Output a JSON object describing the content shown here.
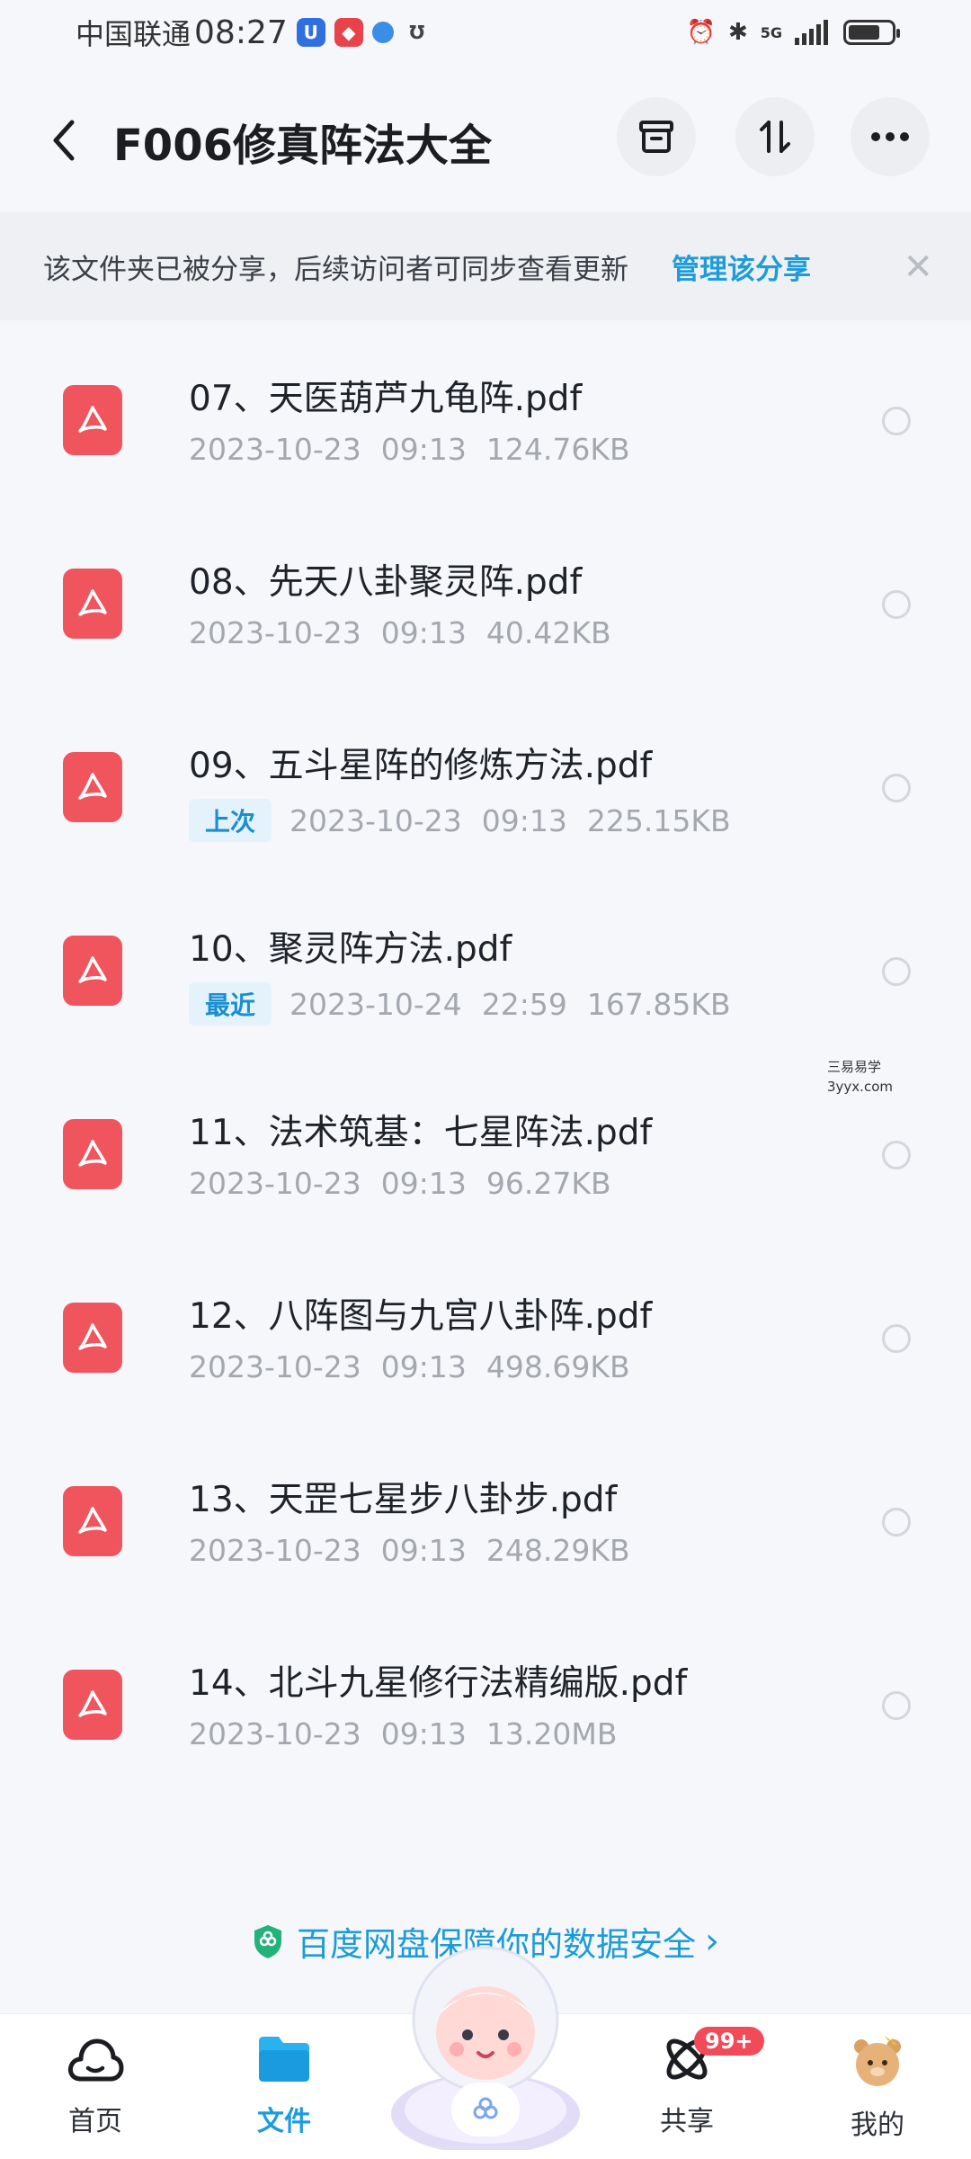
{
  "status_bar": {
    "carrier": "中国联通",
    "time": "08:27",
    "network": "5G"
  },
  "header": {
    "title": "F006修真阵法大全"
  },
  "share_banner": {
    "text": "该文件夹已被分享，后续访问者可同步查看更新",
    "link": "管理该分享"
  },
  "files": [
    {
      "name": "07、天医葫芦九龟阵.pdf",
      "tag": "",
      "date": "2023-10-23",
      "time": "09:13",
      "size": "124.76KB"
    },
    {
      "name": "08、先天八卦聚灵阵.pdf",
      "tag": "",
      "date": "2023-10-23",
      "time": "09:13",
      "size": "40.42KB"
    },
    {
      "name": "09、五斗星阵的修炼方法.pdf",
      "tag": "上次",
      "date": "2023-10-23",
      "time": "09:13",
      "size": "225.15KB"
    },
    {
      "name": "10、聚灵阵方法.pdf",
      "tag": "最近",
      "date": "2023-10-24",
      "time": "22:59",
      "size": "167.85KB"
    },
    {
      "name": "11、法术筑基：七星阵法.pdf",
      "tag": "",
      "date": "2023-10-23",
      "time": "09:13",
      "size": "96.27KB"
    },
    {
      "name": "12、八阵图与九宫八卦阵.pdf",
      "tag": "",
      "date": "2023-10-23",
      "time": "09:13",
      "size": "498.69KB"
    },
    {
      "name": "13、天罡七星步八卦步.pdf",
      "tag": "",
      "date": "2023-10-23",
      "time": "09:13",
      "size": "248.29KB"
    },
    {
      "name": "14、北斗九星修行法精编版.pdf",
      "tag": "",
      "date": "2023-10-23",
      "time": "09:13",
      "size": "13.20MB"
    }
  ],
  "watermark": {
    "line1": "三易易学",
    "line2": "3yyx.com"
  },
  "security": {
    "text": "百度网盘保障你的数据安全"
  },
  "tabbar": {
    "home": "首页",
    "files": "文件",
    "share": "共享",
    "share_badge": "99+",
    "mine": "我的"
  },
  "colors": {
    "accent": "#1e9be0",
    "pdf": "#f0555e",
    "badge": "#f34a5a"
  }
}
